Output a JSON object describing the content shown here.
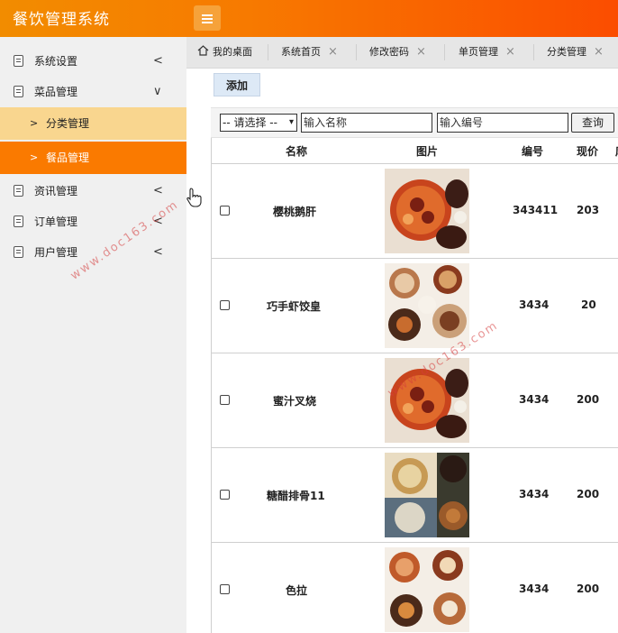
{
  "app": {
    "title": "餐饮管理系统"
  },
  "sidebar": {
    "items": [
      {
        "label": "系统设置",
        "arrow": "<"
      },
      {
        "label": "菜品管理",
        "arrow": "∨"
      },
      {
        "label": "资讯管理",
        "arrow": "<"
      },
      {
        "label": "订单管理",
        "arrow": "<"
      },
      {
        "label": "用户管理",
        "arrow": "<"
      }
    ],
    "subitems": [
      {
        "label": "分类管理",
        "arrow": ">"
      },
      {
        "label": "餐品管理",
        "arrow": ">"
      }
    ]
  },
  "tabs": [
    {
      "label": "我的桌面",
      "close": ""
    },
    {
      "label": "系统首页",
      "close": "×"
    },
    {
      "label": "修改密码",
      "close": "×"
    },
    {
      "label": "单页管理",
      "close": "×"
    },
    {
      "label": "分类管理",
      "close": "×"
    }
  ],
  "toolbar": {
    "add_label": "添加"
  },
  "search": {
    "select_value": "-- 请选择 --",
    "name_placeholder": "输入名称",
    "code_placeholder": "输入编号",
    "query_label": "查询"
  },
  "table": {
    "columns": [
      "名称",
      "图片",
      "编号",
      "现价",
      "库"
    ],
    "rows": [
      {
        "name": "樱桃鹅肝",
        "code": "343411",
        "price": "203",
        "image": "dish-a"
      },
      {
        "name": "巧手虾饺皇",
        "code": "3434",
        "price": "20",
        "image": "dish-b"
      },
      {
        "name": "蜜汁叉烧",
        "code": "3434",
        "price": "200",
        "image": "dish-a"
      },
      {
        "name": "糖醋排骨11",
        "code": "3434",
        "price": "200",
        "image": "dish-c"
      },
      {
        "name": "色拉",
        "code": "3434",
        "price": "200",
        "image": "dish-a"
      }
    ]
  },
  "watermarks": [
    "www.doc163.com",
    "www.doc163.com",
    "www.doc163.com"
  ],
  "colors": {
    "header_start": "#f28c00",
    "header_end": "#fb4d00",
    "active_sub": "#fa7a00",
    "sub_bg": "#f9d68f"
  }
}
